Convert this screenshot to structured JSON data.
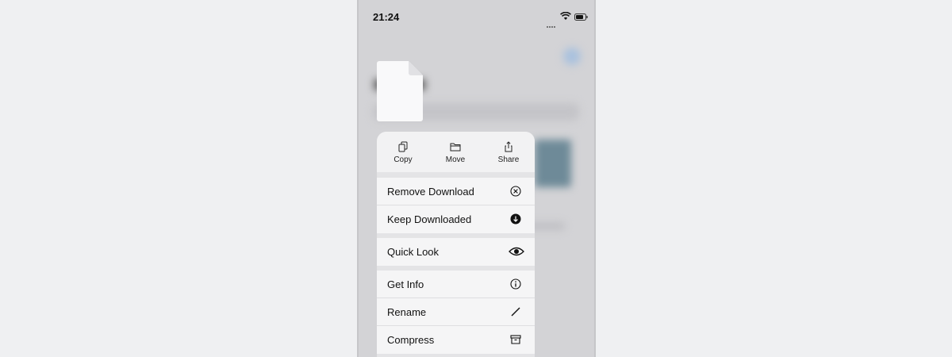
{
  "status_bar": {
    "time": "21:24"
  },
  "actions": [
    {
      "label": "Copy",
      "icon": "copy-icon"
    },
    {
      "label": "Move",
      "icon": "folder-icon"
    },
    {
      "label": "Share",
      "icon": "share-icon"
    }
  ],
  "menu": {
    "group1": [
      {
        "label": "Remove Download",
        "icon": "remove-circle-icon"
      },
      {
        "label": "Keep Downloaded",
        "icon": "download-circle-icon"
      }
    ],
    "group2": [
      {
        "label": "Quick Look",
        "icon": "eye-icon"
      }
    ],
    "group3": [
      {
        "label": "Get Info",
        "icon": "info-icon"
      },
      {
        "label": "Rename",
        "icon": "pencil-icon"
      },
      {
        "label": "Compress",
        "icon": "archive-icon"
      }
    ]
  }
}
